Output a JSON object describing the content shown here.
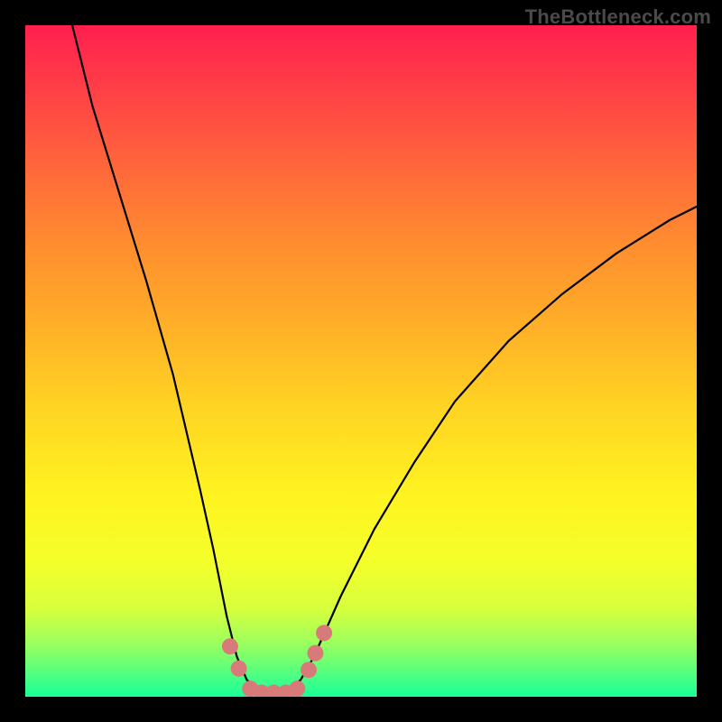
{
  "watermark": "TheBottleneck.com",
  "chart_data": {
    "type": "line",
    "title": "",
    "xlabel": "",
    "ylabel": "",
    "xlim": [
      0,
      100
    ],
    "ylim": [
      0,
      100
    ],
    "grid": false,
    "legend": false,
    "series": [
      {
        "name": "bottleneck-curve",
        "x": [
          7,
          10,
          14,
          18,
          22,
          26,
          28,
          30,
          31.5,
          33,
          35,
          37,
          39,
          41,
          43,
          47,
          52,
          58,
          64,
          72,
          80,
          88,
          96,
          100
        ],
        "y": [
          100,
          88,
          75,
          62,
          48,
          31,
          22,
          12,
          6,
          2.5,
          0.8,
          0.5,
          0.8,
          2.5,
          6,
          15,
          25,
          35,
          44,
          53,
          60,
          66,
          71,
          73
        ]
      }
    ],
    "markers": {
      "name": "highlight-dots",
      "points": [
        {
          "x": 30.5,
          "y": 7.5
        },
        {
          "x": 31.8,
          "y": 4.2
        },
        {
          "x": 33.5,
          "y": 1.2
        },
        {
          "x": 35.2,
          "y": 0.6
        },
        {
          "x": 37.0,
          "y": 0.6
        },
        {
          "x": 38.8,
          "y": 0.6
        },
        {
          "x": 40.5,
          "y": 1.2
        },
        {
          "x": 42.2,
          "y": 4.0
        },
        {
          "x": 43.2,
          "y": 6.5
        },
        {
          "x": 44.5,
          "y": 9.5
        }
      ],
      "color": "#d97a7a",
      "radius_px": 9
    },
    "gradient_stops": [
      {
        "pos": 0,
        "color": "#ff1f4f"
      },
      {
        "pos": 8,
        "color": "#ff3a48"
      },
      {
        "pos": 22,
        "color": "#ff6a3a"
      },
      {
        "pos": 33,
        "color": "#ff8e2f"
      },
      {
        "pos": 46,
        "color": "#ffb327"
      },
      {
        "pos": 57,
        "color": "#ffd423"
      },
      {
        "pos": 70,
        "color": "#fff321"
      },
      {
        "pos": 80,
        "color": "#f4ff2a"
      },
      {
        "pos": 87,
        "color": "#d6ff3e"
      },
      {
        "pos": 92,
        "color": "#9cff5e"
      },
      {
        "pos": 96,
        "color": "#5bff7c"
      },
      {
        "pos": 100,
        "color": "#18ff98"
      }
    ]
  }
}
